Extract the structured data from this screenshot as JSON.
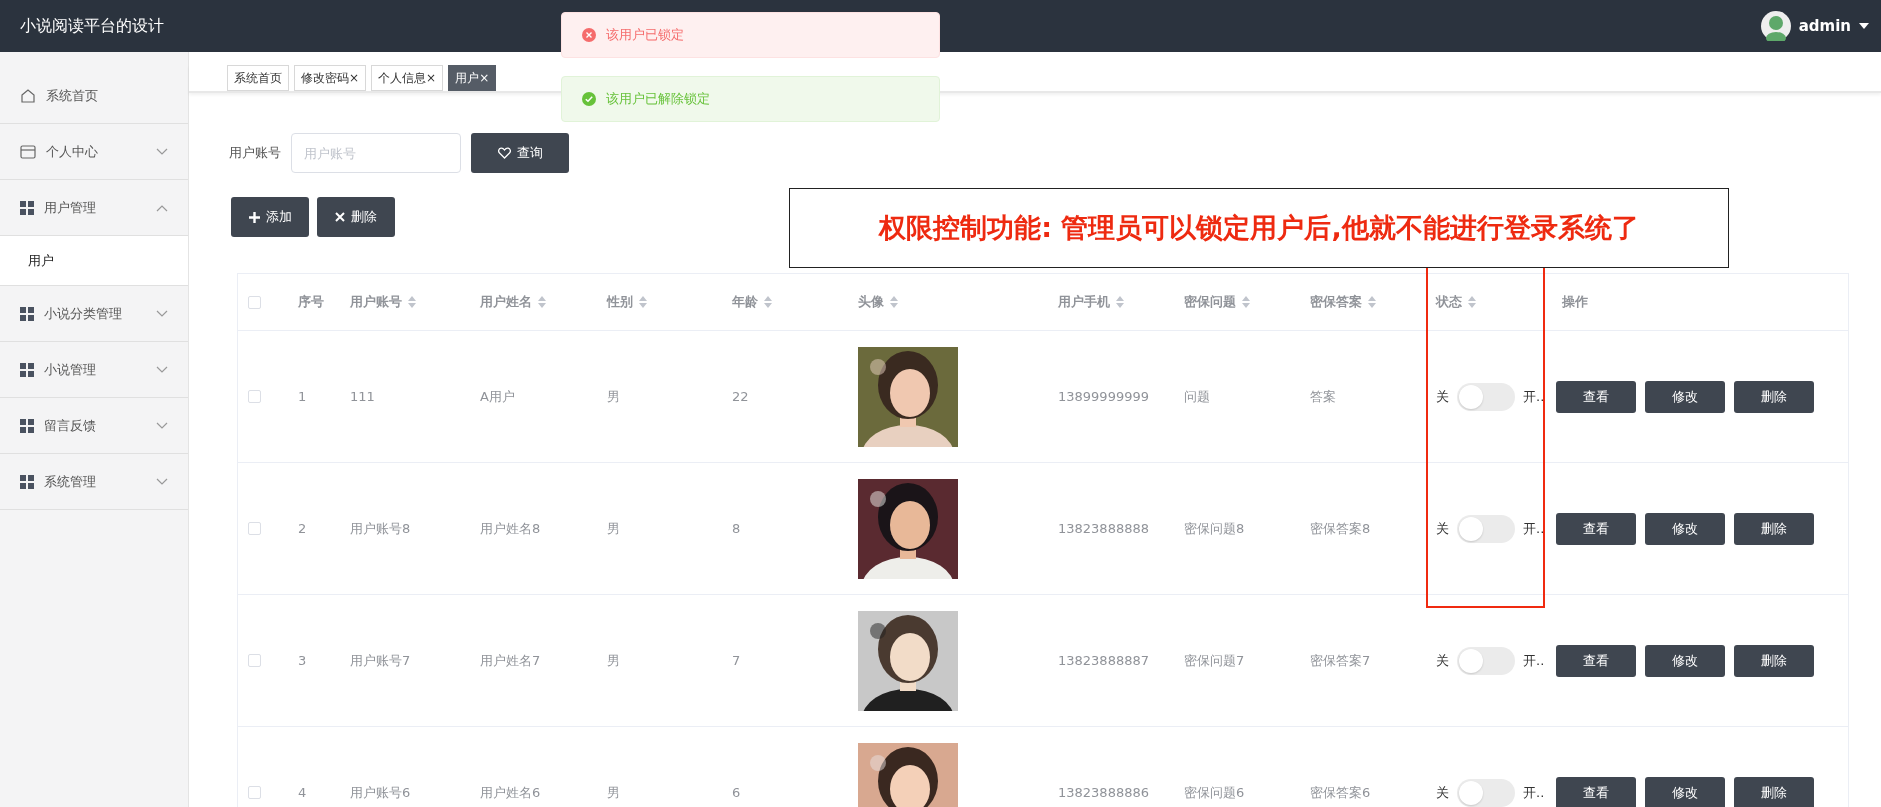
{
  "header": {
    "title": "小说阅读平台的设计",
    "user": "admin"
  },
  "toasts": [
    {
      "kind": "error",
      "text": "该用户已锁定"
    },
    {
      "kind": "success",
      "text": "该用户已解除锁定"
    }
  ],
  "sidebar": {
    "items": [
      {
        "label": "系统首页"
      },
      {
        "label": "个人中心",
        "expanded": false
      },
      {
        "label": "用户管理",
        "expanded": true,
        "children": [
          {
            "label": "用户",
            "selected": true
          }
        ]
      },
      {
        "label": "小说分类管理",
        "expanded": false
      },
      {
        "label": "小说管理",
        "expanded": false
      },
      {
        "label": "留言反馈",
        "expanded": false
      },
      {
        "label": "系统管理",
        "expanded": false
      }
    ]
  },
  "tabs": [
    {
      "label": "系统首页",
      "selected": false
    },
    {
      "label": "修改密码",
      "close": "×",
      "selected": false
    },
    {
      "label": "个人信息",
      "close": "×",
      "selected": false
    },
    {
      "label": "用户",
      "close": "×",
      "selected": true
    }
  ],
  "search": {
    "label": "用户账号",
    "placeholder": "用户账号",
    "button": "查询"
  },
  "actions": [
    {
      "kind": "add",
      "label": "添加"
    },
    {
      "kind": "delete",
      "label": "删除"
    }
  ],
  "annotation": "权限控制功能: 管理员可以锁定用户后,他就不能进行登录系统了",
  "table": {
    "all_selected": false,
    "columns": [
      {
        "label": "序号",
        "sortable": false
      },
      {
        "label": "用户账号",
        "sortable": true
      },
      {
        "label": "用户姓名",
        "sortable": true
      },
      {
        "label": "性别",
        "sortable": true
      },
      {
        "label": "年龄",
        "sortable": true
      },
      {
        "label": "头像",
        "sortable": true
      },
      {
        "label": "用户手机",
        "sortable": true
      },
      {
        "label": "密保问题",
        "sortable": true
      },
      {
        "label": "密保答案",
        "sortable": true
      },
      {
        "label": "状态",
        "sortable": true
      },
      {
        "label": "操作",
        "sortable": false
      }
    ],
    "rows": [
      {
        "selected": false,
        "cells": [
          "1",
          "111",
          "A用户",
          "男",
          "22"
        ],
        "avatar": {
          "kind": "picture"
        },
        "more": [
          "13899999999",
          "问题",
          "答案"
        ],
        "status": {
          "off": "关",
          "on": "开..",
          "checked": false
        },
        "buttons": [
          "查看",
          "修改",
          "删除"
        ]
      },
      {
        "selected": false,
        "cells": [
          "2",
          "用户账号8",
          "用户姓名8",
          "男",
          "8"
        ],
        "avatar": {
          "kind": "picture"
        },
        "more": [
          "13823888888",
          "密保问题8",
          "密保答案8"
        ],
        "status": {
          "off": "关",
          "on": "开..",
          "checked": false
        },
        "buttons": [
          "查看",
          "修改",
          "删除"
        ]
      },
      {
        "selected": false,
        "cells": [
          "3",
          "用户账号7",
          "用户姓名7",
          "男",
          "7"
        ],
        "avatar": {
          "kind": "picture"
        },
        "more": [
          "13823888887",
          "密保问题7",
          "密保答案7"
        ],
        "status": {
          "off": "关",
          "on": "开..",
          "checked": false
        },
        "buttons": [
          "查看",
          "修改",
          "删除"
        ]
      },
      {
        "selected": false,
        "cells": [
          "4",
          "用户账号6",
          "用户姓名6",
          "男",
          "6"
        ],
        "avatar": {
          "kind": "picture"
        },
        "more": [
          "13823888886",
          "密保问题6",
          "密保答案6"
        ],
        "status": {
          "off": "关",
          "on": "开..",
          "checked": false
        },
        "buttons": [
          "查看",
          "修改",
          "删除"
        ]
      }
    ]
  }
}
